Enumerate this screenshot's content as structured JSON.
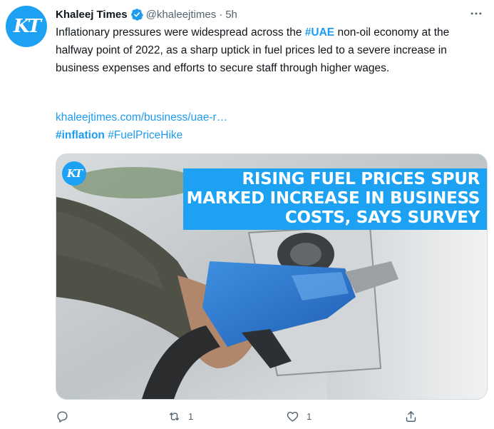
{
  "account": {
    "avatar_text": "KT",
    "name": "Khaleej Times",
    "handle": "@khaleejtimes",
    "separator": "·",
    "time": "5h"
  },
  "tweet": {
    "text_before": "Inflationary pressures were widespread across the ",
    "hashtag_uae": "#UAE",
    "text_after": " non-oil economy at the halfway point of 2022, as a sharp uptick in fuel prices led to a severe increase in business expenses and efforts to secure staff through higher wages.",
    "link": "khaleejtimes.com/business/uae-r…",
    "hashtag_inflation": "#inflation",
    "hashtag_fuel": "#FuelPriceHike"
  },
  "media": {
    "logo_text": "KT",
    "headline_line1": "Rising fuel prices spur",
    "headline_line2": "marked increase in business",
    "headline_line3": "costs, says survey"
  },
  "actions": {
    "reply_count": "",
    "retweet_count": "1",
    "like_count": "1"
  },
  "colors": {
    "accent": "#1d9bf0",
    "muted": "#536471",
    "text": "#0f1419"
  },
  "icons": [
    "verified-badge-icon",
    "more-icon",
    "reply-icon",
    "retweet-icon",
    "like-icon",
    "share-icon"
  ]
}
